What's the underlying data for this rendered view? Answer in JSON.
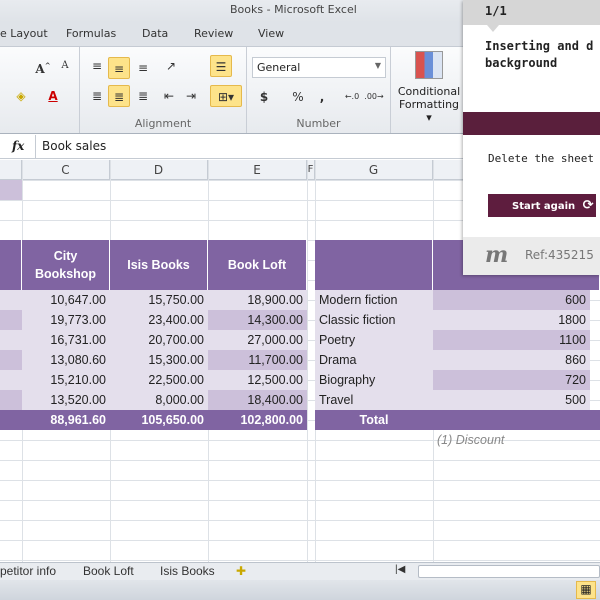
{
  "window": {
    "title": "Books - Microsoft Excel"
  },
  "ribbon_tabs": [
    "e Layout",
    "Formulas",
    "Data",
    "Review",
    "View"
  ],
  "ribbon": {
    "alignment_label": "Alignment",
    "number_label": "Number",
    "number_format": "General",
    "conditional_formatting": "Conditional",
    "conditional_formatting2": "Formatting ▾",
    "currency": "$",
    "percent": "%",
    "comma": ","
  },
  "formula_bar": {
    "fx": "fx",
    "value": "Book sales"
  },
  "columns": [
    "C",
    "D",
    "E",
    "F",
    "G"
  ],
  "table1": {
    "headers": [
      "City Bookshop",
      "Isis Books",
      "Book Loft"
    ],
    "rows": [
      [
        "10,647.00",
        "15,750.00",
        "18,900.00"
      ],
      [
        "19,773.00",
        "23,400.00",
        "14,300.00"
      ],
      [
        "16,731.00",
        "20,700.00",
        "27,000.00"
      ],
      [
        "13,080.60",
        "15,300.00",
        "11,700.00"
      ],
      [
        "15,210.00",
        "22,500.00",
        "12,500.00"
      ],
      [
        "13,520.00",
        "8,000.00",
        "18,400.00"
      ]
    ],
    "totals": [
      "88,961.60",
      "105,650.00",
      "102,800.00"
    ]
  },
  "table2": {
    "rows": [
      [
        "Modern fiction",
        "600"
      ],
      [
        "Classic fiction",
        "1800"
      ],
      [
        "Poetry",
        "1100"
      ],
      [
        "Drama",
        "860"
      ],
      [
        "Biography",
        "720"
      ],
      [
        "Travel",
        "500"
      ]
    ],
    "total_label": "Total",
    "note": "(1) Discount"
  },
  "sheet_tabs": [
    "petitor info",
    "Book Loft",
    "Isis Books"
  ],
  "panel": {
    "step": "1/1",
    "title": "Inserting and d background",
    "instruction": "Delete the sheet",
    "button": "Start again",
    "ref": "Ref:435215",
    "logo": "m"
  },
  "colors": {
    "header": "#8064a2",
    "light": "#e4dfec",
    "mid": "#ccc0da",
    "panel_bar": "#5a1f3c",
    "button": "#5e1d3e"
  }
}
